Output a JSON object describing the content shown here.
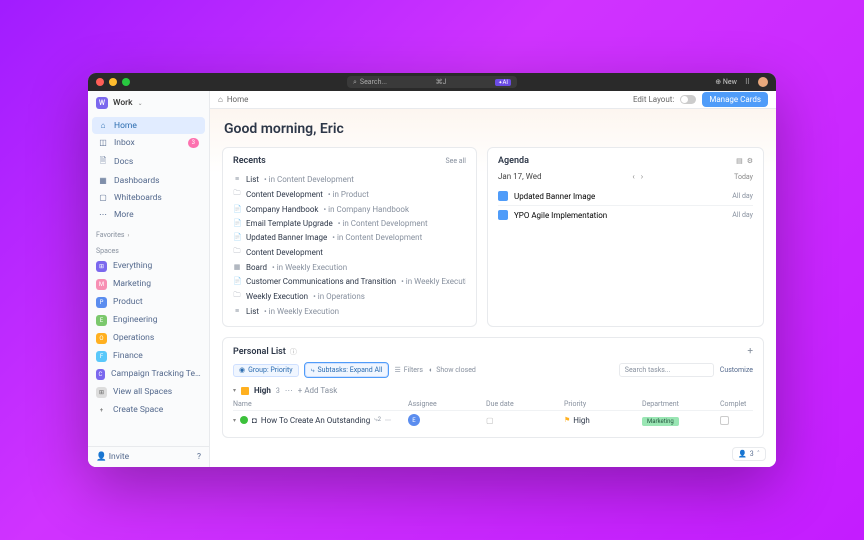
{
  "chrome": {
    "search_placeholder": "Search...",
    "shortcut": "⌘J",
    "ai_label": "AI",
    "new_label": "New"
  },
  "workspace": {
    "name": "Work",
    "initial": "W"
  },
  "nav": {
    "home": "Home",
    "inbox": "Inbox",
    "inbox_count": "3",
    "docs": "Docs",
    "dashboards": "Dashboards",
    "whiteboards": "Whiteboards",
    "more": "More"
  },
  "sections": {
    "favorites": "Favorites",
    "spaces": "Spaces"
  },
  "spaces": [
    {
      "name": "Everything",
      "color": "#7b68ee",
      "initial": "⊞"
    },
    {
      "name": "Marketing",
      "color": "#f78fb3",
      "initial": "M"
    },
    {
      "name": "Product",
      "color": "#5b8def",
      "initial": "P"
    },
    {
      "name": "Engineering",
      "color": "#7bc86c",
      "initial": "E"
    },
    {
      "name": "Operations",
      "color": "#ffb020",
      "initial": "O"
    },
    {
      "name": "Finance",
      "color": "#5ac8fa",
      "initial": "F"
    },
    {
      "name": "Campaign Tracking Template",
      "color": "#7b68ee",
      "initial": "C"
    }
  ],
  "space_actions": {
    "view_all": "View all Spaces",
    "create": "Create Space"
  },
  "sidebar_footer": {
    "invite": "Invite"
  },
  "topbar": {
    "crumb": "Home",
    "edit_layout": "Edit Layout:",
    "manage_cards": "Manage Cards"
  },
  "greeting": "Good morning, Eric",
  "recents": {
    "title": "Recents",
    "see_all": "See all",
    "items": [
      {
        "icon": "≡",
        "name": "List",
        "ctx": "• in Content Development"
      },
      {
        "icon": "🗀",
        "name": "Content Development",
        "ctx": "• in Product"
      },
      {
        "icon": "📄",
        "name": "Company Handbook",
        "ctx": "• in Company Handbook"
      },
      {
        "icon": "📄",
        "name": "Email Template Upgrade",
        "ctx": "• in Content Development"
      },
      {
        "icon": "📄",
        "name": "Updated Banner Image",
        "ctx": "• in Content Development"
      },
      {
        "icon": "🗀",
        "name": "Content Development",
        "ctx": ""
      },
      {
        "icon": "▦",
        "name": "Board",
        "ctx": "• in Weekly Execution"
      },
      {
        "icon": "📄",
        "name": "Customer Communications and Transition",
        "ctx": "• in Weekly Execution"
      },
      {
        "icon": "🗀",
        "name": "Weekly Execution",
        "ctx": "• in Operations"
      },
      {
        "icon": "≡",
        "name": "List",
        "ctx": "• in Weekly Execution"
      }
    ]
  },
  "agenda": {
    "title": "Agenda",
    "date": "Jan 17, Wed",
    "today": "Today",
    "items": [
      {
        "name": "Updated Banner Image",
        "time": "All day"
      },
      {
        "name": "YPO Agile Implementation",
        "time": "All day"
      }
    ]
  },
  "personal": {
    "title": "Personal List",
    "chips": {
      "group": "Group: Priority",
      "subtasks": "Subtasks: Expand All"
    },
    "filters": "Filters",
    "show_closed": "Show closed",
    "search_placeholder": "Search tasks...",
    "customize": "Customize",
    "group_label": "High",
    "group_count": "3",
    "add_task": "Add Task",
    "cols": {
      "name": "Name",
      "assignee": "Assignee",
      "due": "Due date",
      "priority": "Priority",
      "dept": "Department",
      "complete": "Complet"
    },
    "task": {
      "name": "How To Create An Outstanding ",
      "sub": "2",
      "assignee": "E",
      "priority": "High",
      "dept": "Marketing"
    }
  },
  "floater": {
    "count": "3"
  }
}
